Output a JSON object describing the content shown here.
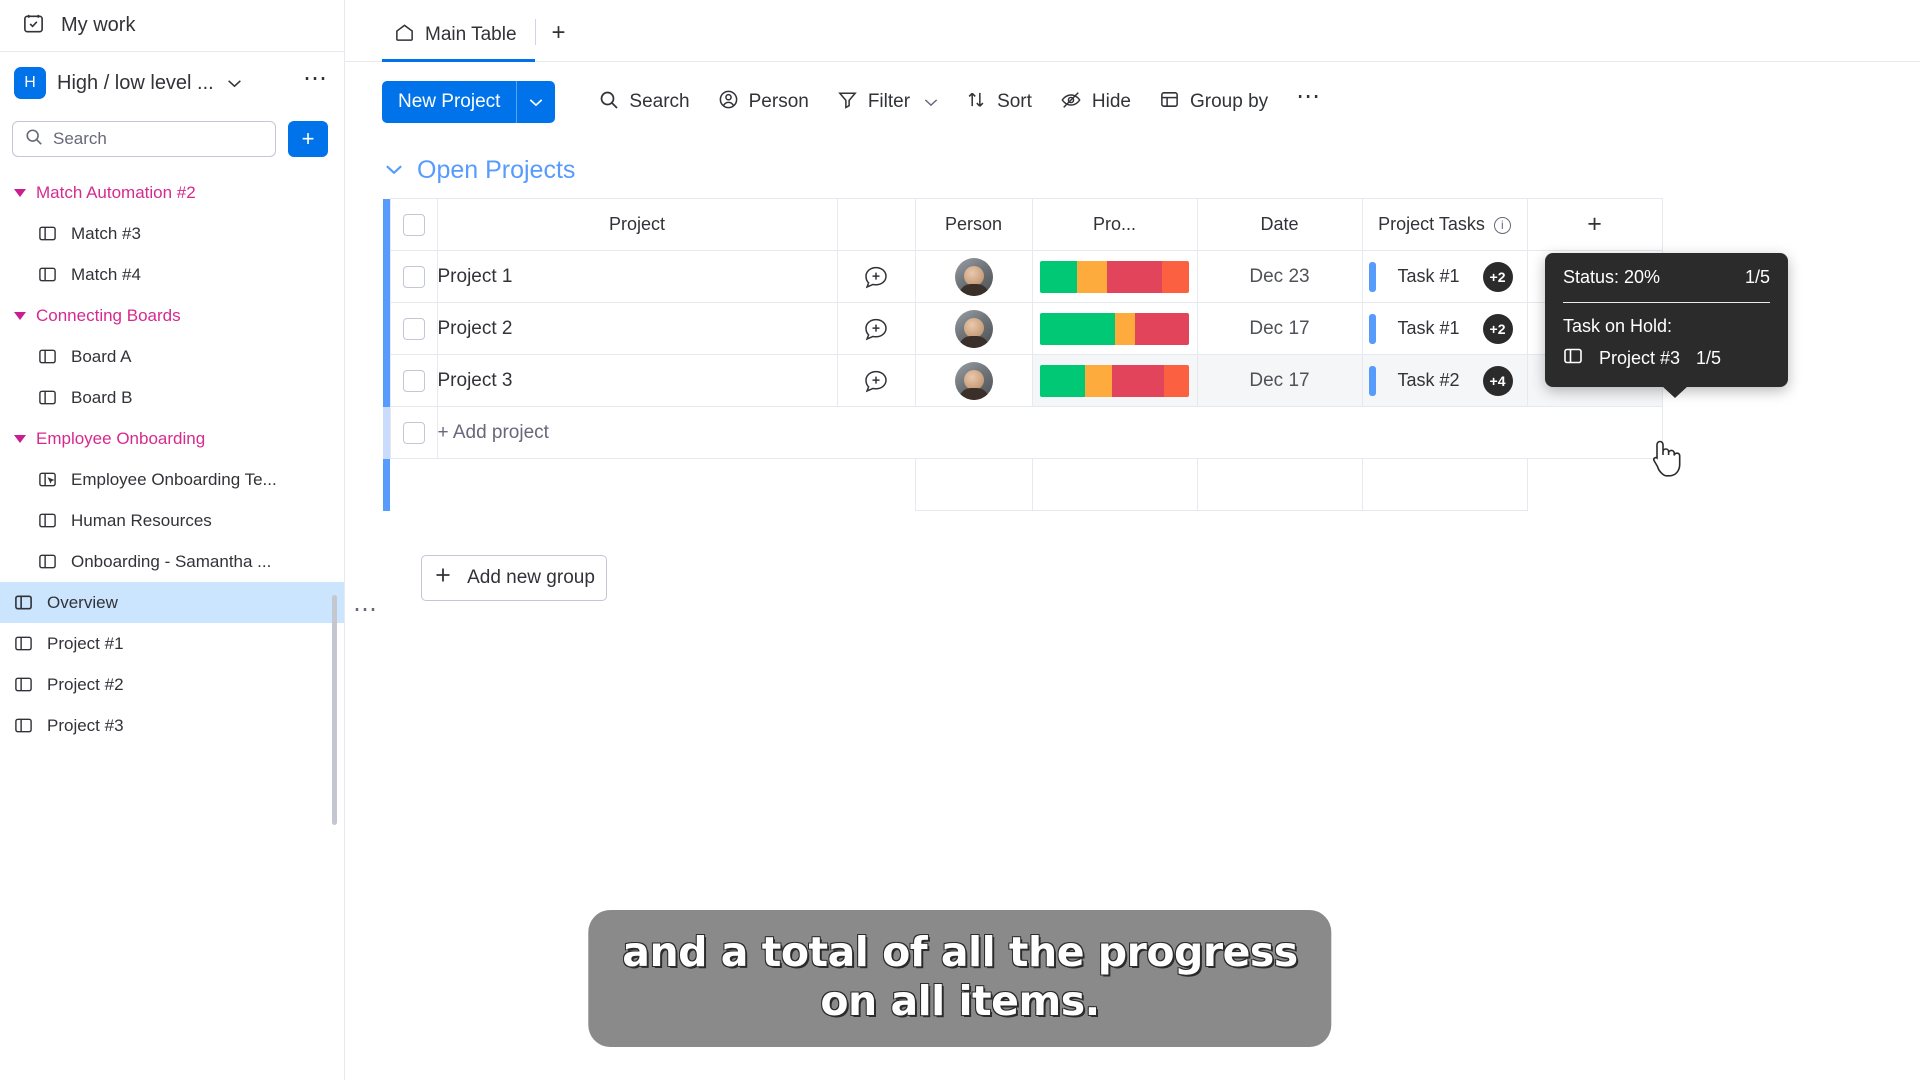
{
  "sidebar": {
    "my_work": "My work",
    "board": {
      "avatar_letter": "H",
      "title": "High / low level ...",
      "menu_icon": "⋯"
    },
    "search": {
      "placeholder": "Search",
      "add_label": "+"
    },
    "groups": [
      {
        "label": "Match Automation #2",
        "items": [
          {
            "label": "Match #3",
            "icon": "board-icon"
          },
          {
            "label": "Match #4",
            "icon": "board-icon"
          }
        ]
      },
      {
        "label": "Connecting Boards",
        "items": [
          {
            "label": "Board A",
            "icon": "board-icon"
          },
          {
            "label": "Board B",
            "icon": "board-icon"
          }
        ]
      },
      {
        "label": "Employee Onboarding",
        "items": [
          {
            "label": "Employee Onboarding Te...",
            "icon": "board-cursor-icon"
          },
          {
            "label": "Human Resources",
            "icon": "board-icon"
          },
          {
            "label": "Onboarding - Samantha ...",
            "icon": "board-icon"
          }
        ]
      }
    ],
    "flat_items": [
      {
        "label": "Overview",
        "active": true
      },
      {
        "label": "Project #1",
        "active": false
      },
      {
        "label": "Project #2",
        "active": false
      },
      {
        "label": "Project #3",
        "active": false
      }
    ]
  },
  "tabs": {
    "items": [
      {
        "label": "Main Table",
        "icon": "home-icon",
        "active": true
      }
    ],
    "add_label": "+"
  },
  "toolbar": {
    "new_button": {
      "label": "New Project",
      "caret": "⌄"
    },
    "items": [
      {
        "label": "Search",
        "icon": "search-icon",
        "caret": ""
      },
      {
        "label": "Person",
        "icon": "person-icon",
        "caret": ""
      },
      {
        "label": "Filter",
        "icon": "filter-icon",
        "caret": "⌄"
      },
      {
        "label": "Sort",
        "icon": "sort-icon",
        "caret": ""
      },
      {
        "label": "Hide",
        "icon": "eye-off-icon",
        "caret": ""
      },
      {
        "label": "Group by",
        "icon": "group-icon",
        "caret": ""
      }
    ],
    "more": "⋯"
  },
  "group": {
    "caret": "⌄",
    "title": "Open Projects"
  },
  "table": {
    "columns": [
      {
        "key": "project",
        "label": "Project"
      },
      {
        "key": "updates",
        "label": ""
      },
      {
        "key": "person",
        "label": "Person"
      },
      {
        "key": "progress",
        "label": "Pro..."
      },
      {
        "key": "date",
        "label": "Date"
      },
      {
        "key": "tasks",
        "label": "Project Tasks",
        "info": "i"
      },
      {
        "key": "add",
        "label": "+"
      }
    ],
    "rows": [
      {
        "name": "Project 1",
        "date": "Dec 23",
        "task": "Task #1",
        "badge": "+2",
        "progress": [
          {
            "color": "#00c875",
            "pct": 25
          },
          {
            "color": "#fdab3d",
            "pct": 20
          },
          {
            "color": "#e2445c",
            "pct": 37
          },
          {
            "color": "#fb6140",
            "pct": 18
          }
        ]
      },
      {
        "name": "Project 2",
        "date": "Dec 17",
        "task": "Task #1",
        "badge": "+2",
        "progress": [
          {
            "color": "#00c875",
            "pct": 50
          },
          {
            "color": "#fdab3d",
            "pct": 14
          },
          {
            "color": "#e2445c",
            "pct": 36
          }
        ]
      },
      {
        "name": "Project 3",
        "date": "Dec 17",
        "task": "Task #2",
        "badge": "+4",
        "progress": [
          {
            "color": "#00c875",
            "pct": 30
          },
          {
            "color": "#fdab3d",
            "pct": 18
          },
          {
            "color": "#e2445c",
            "pct": 35
          },
          {
            "color": "#fb6140",
            "pct": 17
          }
        ]
      }
    ],
    "add_row_label": "+ Add project",
    "row_menu": "⋯"
  },
  "add_group_button": {
    "label": "Add new group",
    "icon": "plus-icon"
  },
  "tooltip": {
    "status_label": "Status: 20%",
    "status_count": "1/5",
    "section_label": "Task on Hold:",
    "item_name": "Project #3",
    "item_count": "1/5",
    "item_icon": "board-icon"
  },
  "caption": {
    "line1": "and a total of all the progress",
    "line2": "on all items."
  },
  "colors": {
    "brand_blue": "#0073ea",
    "group_blue": "#579bfc",
    "folder_pink": "#d62a8f",
    "green": "#00c875",
    "yellow": "#fdab3d",
    "red": "#e2445c",
    "orange": "#fb6140",
    "tooltip_bg": "#2b2b2b"
  }
}
